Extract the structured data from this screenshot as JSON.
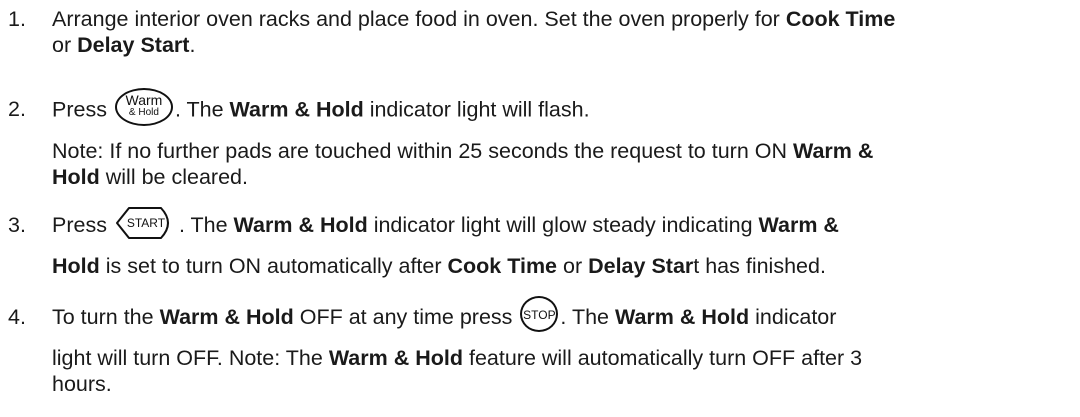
{
  "steps": [
    {
      "num": "1.",
      "lines": [
        [
          {
            "text": "Arrange interior oven racks and place food in oven. Set the oven properly for "
          },
          {
            "text": "Cook Time",
            "bold": true
          }
        ],
        [
          {
            "text": "or "
          },
          {
            "text": "Delay Start",
            "bold": true
          },
          {
            "text": "."
          }
        ]
      ]
    },
    {
      "num": "2.",
      "lines": [
        [
          {
            "text": "Press "
          },
          {
            "pad": "warm"
          },
          {
            "text": ". The "
          },
          {
            "text": "Warm & Hold",
            "bold": true
          },
          {
            "text": " indicator light will flash."
          }
        ],
        [
          {
            "text": "Note: If no further pads are touched within 25 seconds the request to turn ON "
          },
          {
            "text": "Warm &",
            "bold": true
          }
        ],
        [
          {
            "text": "Hold",
            "bold": true
          },
          {
            "text": " will be cleared."
          }
        ]
      ]
    },
    {
      "num": "3.",
      "lines": [
        [
          {
            "text": "Press "
          },
          {
            "pad": "start"
          },
          {
            "text": ". The "
          },
          {
            "text": "Warm & Hold",
            "bold": true
          },
          {
            "text": " indicator light will glow steady indicating "
          },
          {
            "text": "Warm &",
            "bold": true
          }
        ],
        [
          {
            "text": "Hold",
            "bold": true
          },
          {
            "text": " is set to turn ON automatically after "
          },
          {
            "text": "Cook Time",
            "bold": true
          },
          {
            "text": " or "
          },
          {
            "text": "Delay Star",
            "bold": true
          },
          {
            "text": "t has finished."
          }
        ]
      ]
    },
    {
      "num": "4.",
      "lines": [
        [
          {
            "text": "To turn the "
          },
          {
            "text": "Warm & Hold",
            "bold": true
          },
          {
            "text": " OFF at any time press "
          },
          {
            "pad": "stop"
          },
          {
            "text": ". The "
          },
          {
            "text": "Warm & Hold",
            "bold": true
          },
          {
            "text": " indicator"
          }
        ],
        [
          {
            "text": "light will turn OFF. Note: The "
          },
          {
            "text": "Warm & Hold",
            "bold": true
          },
          {
            "text": " feature will automatically turn OFF after 3"
          }
        ],
        [
          {
            "text": "hours."
          }
        ]
      ]
    }
  ],
  "pads": {
    "warm": {
      "line1": "Warm",
      "line2": "& Hold"
    },
    "start": {
      "label": "START"
    },
    "stop": {
      "label": "STOP"
    }
  },
  "colors": {
    "text": "#1a1a1a",
    "background": "#ffffff"
  }
}
